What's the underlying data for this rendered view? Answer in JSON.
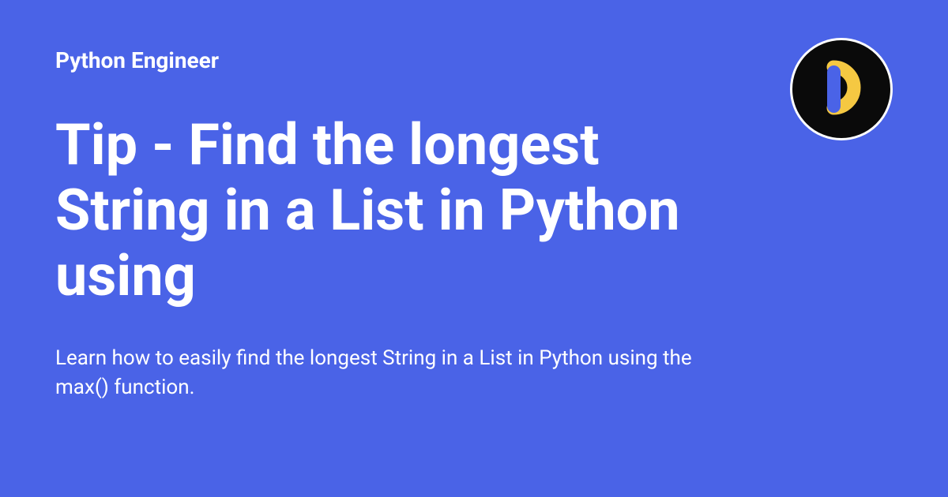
{
  "brand": "Python Engineer",
  "title": "Tip - Find the longest String in a List in Python using",
  "description": "Learn how to easily find the longest String in a List in Python using the max() function.",
  "colors": {
    "background": "#4a63e7",
    "text": "#ffffff",
    "logo_bg": "#0a0a0a",
    "logo_accent_blue": "#4a63e7",
    "logo_accent_yellow": "#f5c842"
  }
}
